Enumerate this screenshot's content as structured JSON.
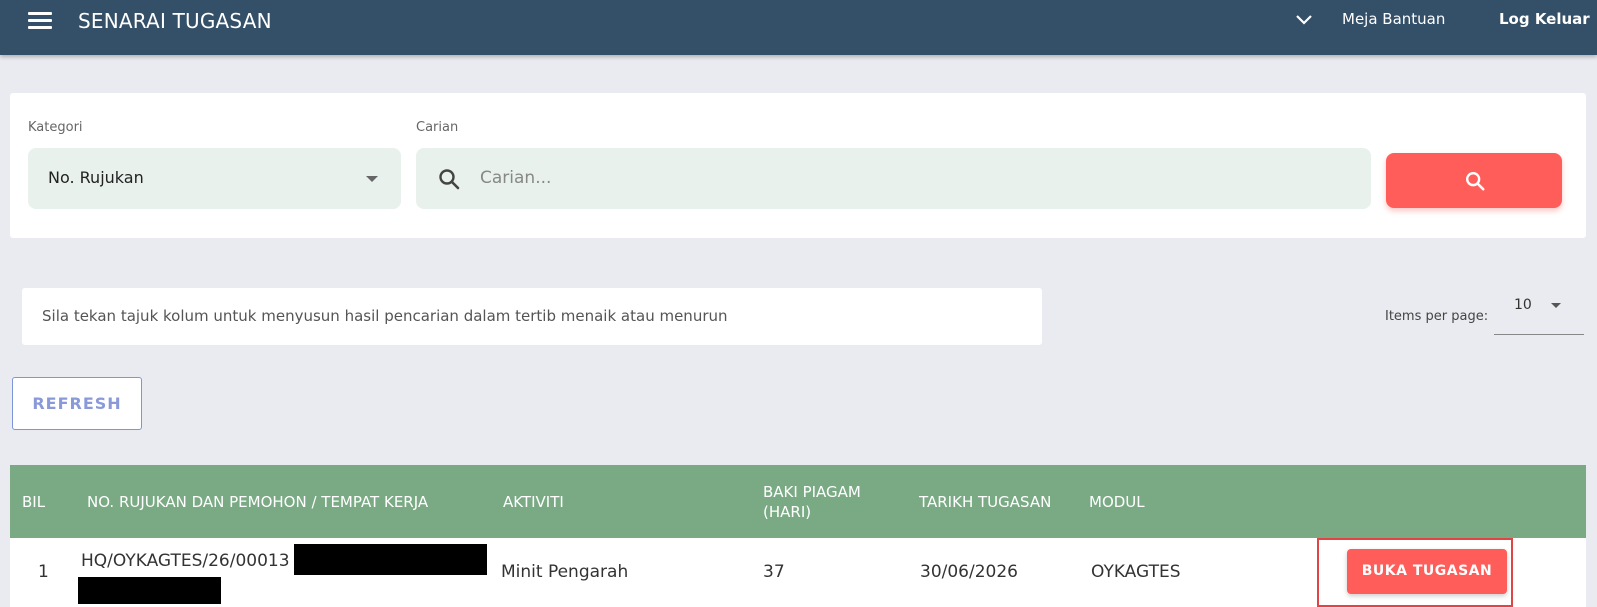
{
  "header": {
    "title": "SENARAI TUGASAN",
    "help_link": "Meja Bantuan",
    "logout_link": "Log Keluar",
    "bg_color": "#344f68"
  },
  "filters": {
    "category_label": "Kategori",
    "category_value": "No. Rujukan",
    "search_label": "Carian",
    "search_placeholder": "Carian...",
    "search_value": "",
    "search_button_icon": "search-icon",
    "search_button_color": "#ff5d5a"
  },
  "info": {
    "sort_hint": "Sila tekan tajuk kolum untuk menyusun hasil pencarian dalam tertib menaik atau menurun"
  },
  "pagination": {
    "items_per_page_label": "Items per page:",
    "items_per_page_value": "10"
  },
  "actions": {
    "refresh_label": "REFRESH"
  },
  "table": {
    "header_color": "#7aaa84",
    "columns": {
      "bil": "BIL",
      "reference": "NO. RUJUKAN DAN PEMOHON / TEMPAT KERJA",
      "activity": "AKTIVITI",
      "days_remaining": "BAKI PIAGAM (HARI)",
      "task_date": "TARIKH TUGASAN",
      "module": "MODUL"
    },
    "rows": [
      {
        "bil": "1",
        "reference": "HQ/OYKAGTES/26/00013",
        "activity": "Minit Pengarah",
        "days_remaining": "37",
        "task_date": "30/06/2026",
        "module": "OYKAGTES",
        "action_label": "BUKA TUGASAN"
      }
    ]
  }
}
